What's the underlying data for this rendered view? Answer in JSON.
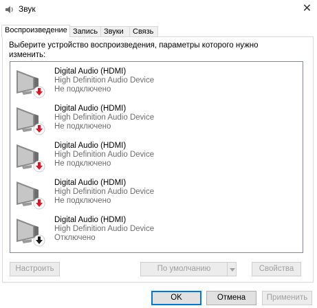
{
  "window": {
    "title": "Звук",
    "close_glyph": "✕"
  },
  "tabs": [
    {
      "label": "Воспроизведение",
      "active": true
    },
    {
      "label": "Запись",
      "active": false
    },
    {
      "label": "Звуки",
      "active": false
    },
    {
      "label": "Связь",
      "active": false
    }
  ],
  "prompt": "Выберите устройство воспроизведения, параметры которого нужно изменить:",
  "devices": [
    {
      "name": "Digital Audio (HDMI)",
      "description": "High Definition Audio Device",
      "status": "Не подключено",
      "badge": "red-down-arrow"
    },
    {
      "name": "Digital Audio (HDMI)",
      "description": "High Definition Audio Device",
      "status": "Не подключено",
      "badge": "red-down-arrow"
    },
    {
      "name": "Digital Audio (HDMI)",
      "description": "High Definition Audio Device",
      "status": "Не подключено",
      "badge": "red-down-arrow"
    },
    {
      "name": "Digital Audio (HDMI)",
      "description": "High Definition Audio Device",
      "status": "Не подключено",
      "badge": "red-down-arrow"
    },
    {
      "name": "Digital Audio (HDMI)",
      "description": "High Definition Audio Device",
      "status": "Отключено",
      "badge": "black-down-arrow"
    }
  ],
  "buttons": {
    "configure": "Настроить",
    "set_default": "По умолчанию",
    "properties": "Свойства",
    "ok": "OK",
    "cancel": "Отмена",
    "apply": "Применить"
  },
  "colors": {
    "badge_red": "#e81123",
    "badge_black": "#1a1a1a",
    "accent": "#0078d7"
  }
}
